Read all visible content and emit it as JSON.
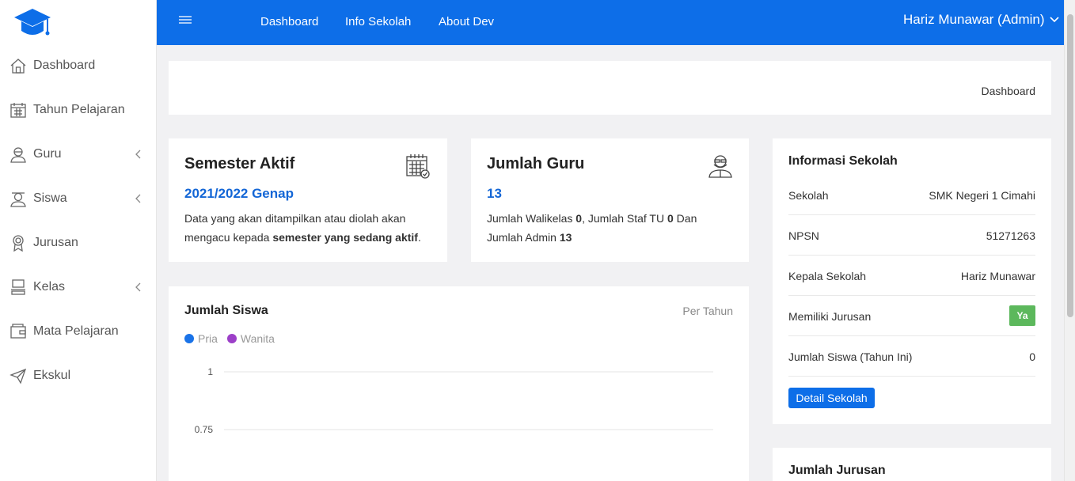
{
  "brand": {
    "logo_icon": "graduation-cap-icon",
    "accent": "#0d6ee8"
  },
  "sidebar": {
    "items": [
      {
        "label": "Dashboard",
        "icon": "home-icon",
        "has_submenu": false
      },
      {
        "label": "Tahun Pelajaran",
        "icon": "calendar-icon",
        "has_submenu": false
      },
      {
        "label": "Guru",
        "icon": "teacher-icon",
        "has_submenu": true
      },
      {
        "label": "Siswa",
        "icon": "student-icon",
        "has_submenu": true
      },
      {
        "label": "Jurusan",
        "icon": "award-icon",
        "has_submenu": false
      },
      {
        "label": "Kelas",
        "icon": "classroom-icon",
        "has_submenu": true
      },
      {
        "label": "Mata Pelajaran",
        "icon": "wallet-icon",
        "has_submenu": false
      },
      {
        "label": "Ekskul",
        "icon": "paper-plane-icon",
        "has_submenu": false
      }
    ]
  },
  "topbar": {
    "links": [
      "Dashboard",
      "Info Sekolah",
      "About Dev"
    ],
    "user": "Hariz Munawar (Admin)"
  },
  "breadcrumb": "Dashboard",
  "semester": {
    "title": "Semester Aktif",
    "value": "2021/2022 Genap",
    "desc_1": "Data yang akan ditampilkan atau diolah akan mengacu kepada ",
    "desc_bold": "semester yang sedang aktif",
    "desc_2": "."
  },
  "guru": {
    "title": "Jumlah Guru",
    "value": "13",
    "t1": "Jumlah Walikelas ",
    "walikelas": "0",
    "t2": ", Jumlah Staf TU ",
    "staf_tu": "0",
    "t3": " Dan Jumlah Admin ",
    "admin": "13"
  },
  "siswa_chart": {
    "title": "Jumlah Siswa",
    "period": "Per Tahun",
    "legend": [
      {
        "name": "Pria",
        "color": "#1a73e8"
      },
      {
        "name": "Wanita",
        "color": "#9c3fc8"
      }
    ]
  },
  "chart_data": {
    "type": "line",
    "title": "Jumlah Siswa",
    "series": [
      {
        "name": "Pria",
        "values": []
      },
      {
        "name": "Wanita",
        "values": []
      }
    ],
    "y_ticks": [
      "1",
      "0.75"
    ],
    "ylim": [
      0,
      1
    ]
  },
  "info": {
    "title": "Informasi Sekolah",
    "rows": [
      {
        "label": "Sekolah",
        "value": "SMK Negeri 1 Cimahi"
      },
      {
        "label": "NPSN",
        "value": "51271263"
      },
      {
        "label": "Kepala Sekolah",
        "value": "Hariz Munawar"
      },
      {
        "label": "Memiliki Jurusan",
        "value": "Ya"
      },
      {
        "label": "Jumlah Siswa (Tahun Ini)",
        "value": "0"
      }
    ],
    "button": "Detail Sekolah"
  },
  "jurusan": {
    "title": "Jumlah Jurusan"
  }
}
